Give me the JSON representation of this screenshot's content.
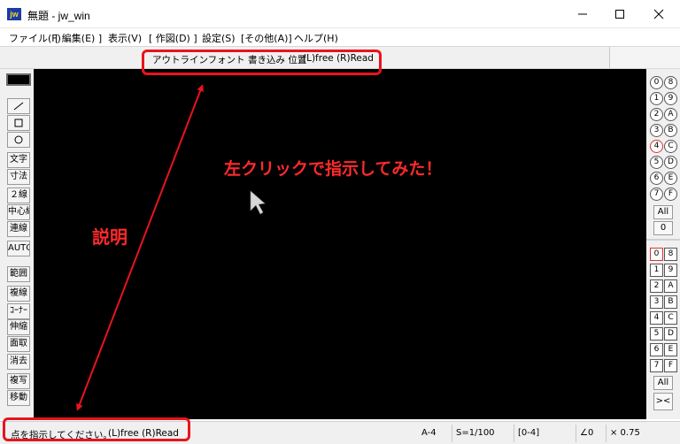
{
  "window": {
    "app_logo": "jw",
    "title": "無題 - jw_win"
  },
  "menu": [
    "ファイル(F)",
    "[ 編集(E) ]",
    "表示(V)",
    "[ 作図(D) ]",
    "設定(S)",
    "[その他(A)]",
    "ヘルプ(H)"
  ],
  "control_bar": {
    "prompt": "アウトラインフォント 書き込み 位置",
    "mouse_hint": "(L)free (R)Read"
  },
  "left_tools": [
    "文字",
    "寸法",
    "２線",
    "中心線",
    "連線",
    "AUTO",
    "範囲",
    "複線",
    "ｺｰﾅｰ",
    "伸縮",
    "面取",
    "消去",
    "複写",
    "移動"
  ],
  "layer_groups": [
    [
      "0",
      "8"
    ],
    [
      "1",
      "9"
    ],
    [
      "2",
      "A"
    ],
    [
      "3",
      "B"
    ],
    [
      "4",
      "C"
    ],
    [
      "5",
      "D"
    ],
    [
      "6",
      "E"
    ],
    [
      "7",
      "F"
    ]
  ],
  "layer_group_all": "All",
  "layer_group_zero": "0",
  "layers": [
    [
      "0",
      "8"
    ],
    [
      "1",
      "9"
    ],
    [
      "2",
      "A"
    ],
    [
      "3",
      "B"
    ],
    [
      "4",
      "C"
    ],
    [
      "5",
      "D"
    ],
    [
      "6",
      "E"
    ],
    [
      "7",
      "F"
    ]
  ],
  "layer_all": "All",
  "layer_extra": "><",
  "status": {
    "message": "点を指示してください。",
    "mouse_hint": "(L)free (R)Read",
    "paper": "A-4",
    "scale": "S=1/100",
    "layer": "[0-4]",
    "angle": "∠0",
    "factor": "× 0.75"
  },
  "annotations": {
    "canvas_note": "左クリックで指示してみた！",
    "explanation": "説明",
    "color": "#e8141e"
  }
}
